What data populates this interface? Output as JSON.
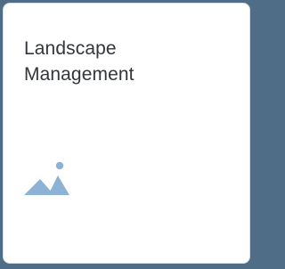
{
  "tile": {
    "title_line1": "Landscape",
    "title_line2": "Management",
    "icon": "landscape-icon",
    "icon_color": "#8cb3d6",
    "background_color": "#4f6d86"
  }
}
